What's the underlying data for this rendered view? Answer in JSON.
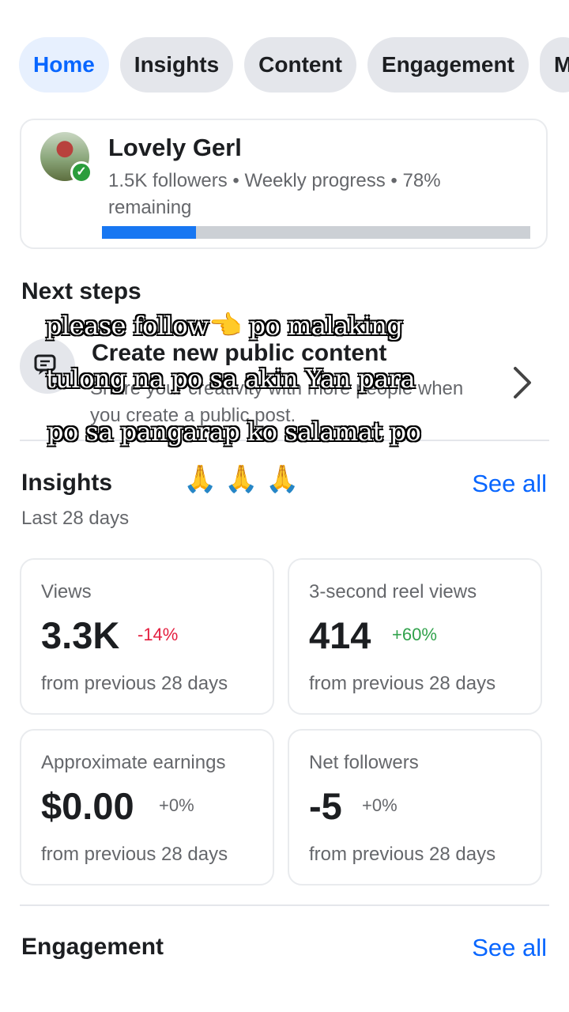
{
  "tabs": [
    {
      "label": "Home"
    },
    {
      "label": "Insights"
    },
    {
      "label": "Content"
    },
    {
      "label": "Engagement"
    },
    {
      "label": "M"
    }
  ],
  "profile": {
    "name": "Lovely Gerl",
    "meta": "1.5K followers • Weekly progress • 78% remaining",
    "progress": 0.22
  },
  "next_steps": {
    "title": "Next steps",
    "step_title": "Create new public content",
    "step_desc": "Share your creativity with more people when you create a public post."
  },
  "insights": {
    "title": "Insights",
    "see_all": "See all",
    "period": "Last 28 days",
    "cards": [
      {
        "label": "Views",
        "value": "3.3K",
        "change": "-14%",
        "footer": "from previous 28 days"
      },
      {
        "label": "3-second reel views",
        "value": "414",
        "change": "+60%",
        "footer": "from previous 28 days"
      },
      {
        "label": "Approximate earnings",
        "value": "$0.00",
        "change": "+0%",
        "footer": "from previous 28 days"
      },
      {
        "label": "Net followers",
        "value": "-5",
        "change": "+0%",
        "footer": "from previous 28 days"
      }
    ]
  },
  "engagement": {
    "title": "Engagement",
    "see_all": "See all"
  },
  "overlay": {
    "line1a": "please follow",
    "line1_emoji": "👈",
    "line1b": "po malaking",
    "line2": "tulong na po sa akin Yan para",
    "line3": "po sa pangarap ko salamat po",
    "emojis": "🙏 🙏 🙏"
  },
  "colors": {
    "accent": "#0866ff",
    "negative": "#e41e3f",
    "positive": "#31a24c"
  }
}
